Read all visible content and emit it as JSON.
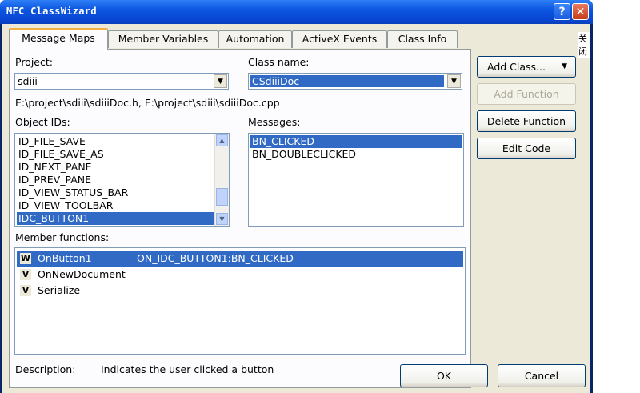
{
  "window": {
    "title": "MFC ClassWizard",
    "help": "?",
    "close": "✕"
  },
  "tabs": [
    "Message Maps",
    "Member Variables",
    "Automation",
    "ActiveX Events",
    "Class Info"
  ],
  "side_text": "关闭",
  "project": {
    "label": "Project:",
    "value": "sdiii"
  },
  "class_name": {
    "label": "Class name:",
    "value": "CSdiiiDoc"
  },
  "file_path": "E:\\project\\sdiii\\sdiiiDoc.h, E:\\project\\sdiii\\sdiiiDoc.cpp",
  "object_ids": {
    "label": "Object IDs:",
    "items": [
      "ID_FILE_SAVE",
      "ID_FILE_SAVE_AS",
      "ID_NEXT_PANE",
      "ID_PREV_PANE",
      "ID_VIEW_STATUS_BAR",
      "ID_VIEW_TOOLBAR",
      "IDC_BUTTON1"
    ],
    "selected": "IDC_BUTTON1"
  },
  "messages": {
    "label": "Messages:",
    "items": [
      "BN_CLICKED",
      "BN_DOUBLECLICKED"
    ],
    "selected": "BN_CLICKED"
  },
  "member_functions": {
    "label": "Member functions:",
    "items": [
      {
        "badge": "W",
        "name": "OnButton1",
        "map": "ON_IDC_BUTTON1:BN_CLICKED"
      },
      {
        "badge": "V",
        "name": "OnNewDocument",
        "map": ""
      },
      {
        "badge": "V",
        "name": "Serialize",
        "map": ""
      }
    ]
  },
  "description": {
    "label": "Description:",
    "text": "Indicates the user clicked a button"
  },
  "buttons": {
    "add_class": "Add Class...",
    "add_function": "Add Function",
    "delete_function": "Delete Function",
    "edit_code": "Edit Code",
    "ok": "OK",
    "cancel": "Cancel"
  },
  "colors": {
    "selection": "#316ac5",
    "dialog": "#ece9d8",
    "titlebar": "#0a56e0"
  }
}
